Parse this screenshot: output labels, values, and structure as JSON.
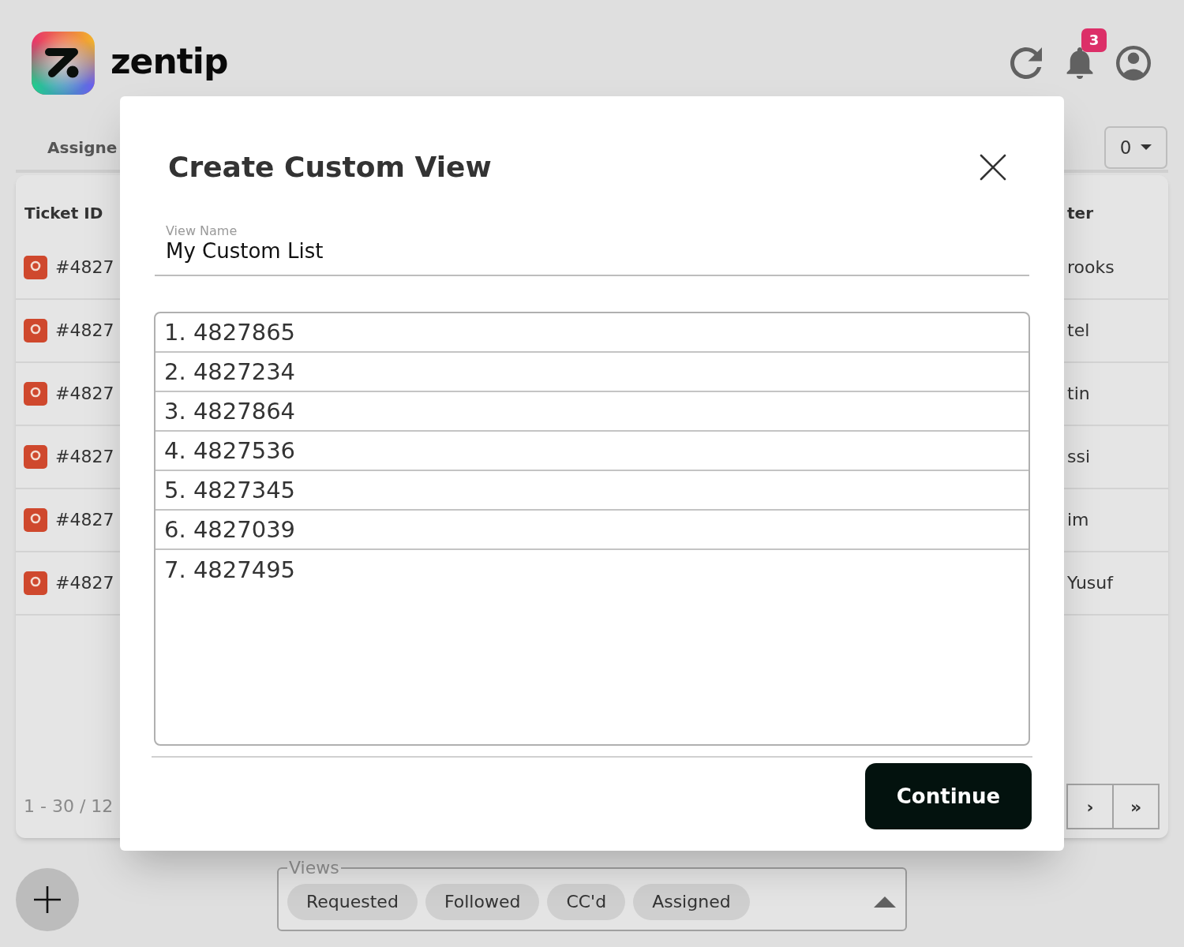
{
  "header": {
    "brand": "zentip",
    "notifications": {
      "count": "3"
    }
  },
  "tab": {
    "label": "Assigne"
  },
  "page_size": {
    "value": "0"
  },
  "table": {
    "columns": [
      "Ticket ID",
      "ter"
    ],
    "rows": [
      {
        "ticket_id": "#4827",
        "column_2": "rooks"
      },
      {
        "ticket_id": "#4827",
        "column_2": "tel"
      },
      {
        "ticket_id": "#4827",
        "column_2": "tin"
      },
      {
        "ticket_id": "#4827",
        "column_2": "ssi"
      },
      {
        "ticket_id": "#4827",
        "column_2": "im"
      },
      {
        "ticket_id": "#4827",
        "column_2": "Yusuf"
      }
    ]
  },
  "pagination": {
    "range": "1 - 30 / 12",
    "buttons": [
      "›",
      "»"
    ]
  },
  "dialog": {
    "title": "Create Custom View",
    "view_name": {
      "label": "View Name",
      "value": "My Custom List"
    },
    "ticket_list": [
      "1. 4827865",
      "2. 4827234",
      "3. 4827864",
      "4. 4827536",
      "5. 4827345",
      "6. 4827039",
      "7. 4827495"
    ],
    "buttons": [
      "Continue"
    ]
  },
  "views": {
    "label": "Views",
    "chips": [
      "Requested",
      "Followed",
      "CC'd",
      "Assigned"
    ]
  }
}
